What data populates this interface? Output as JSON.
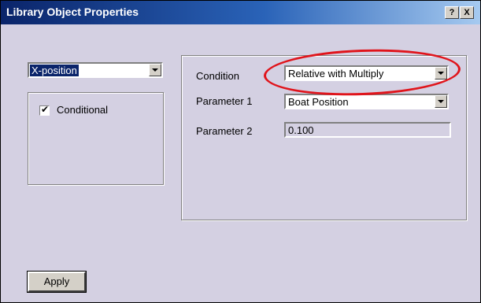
{
  "window": {
    "title": "Library Object Properties",
    "help_button": "?",
    "close_button": "X"
  },
  "left": {
    "property_select": "X-position",
    "conditional_label": "Conditional",
    "conditional_checked": true
  },
  "condition_panel": {
    "condition_label": "Condition",
    "condition_value": "Relative with Multiply",
    "param1_label": "Parameter 1",
    "param1_value": "Boat Position",
    "param2_label": "Parameter 2",
    "param2_value": "0.100"
  },
  "apply_label": "Apply",
  "colors": {
    "dialog_bg": "#d4d0e2",
    "title_bar": "#0a246a",
    "highlight": "#e0141b"
  }
}
